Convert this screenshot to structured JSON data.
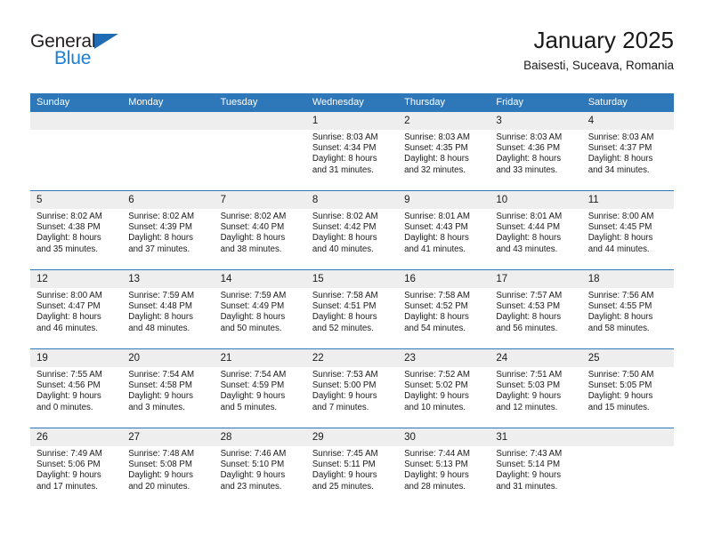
{
  "brand": {
    "name_top": "General",
    "name_bottom": "Blue",
    "accent_color": "#1b7fd4",
    "triangle_color": "#1f6cb4"
  },
  "header": {
    "title": "January 2025",
    "subtitle": "Baisesti, Suceava, Romania"
  },
  "colors": {
    "header_row": "#2e77b8",
    "daynum_band": "#eeeeee",
    "text": "#1a1a1a"
  },
  "weekday_headers": [
    "Sunday",
    "Monday",
    "Tuesday",
    "Wednesday",
    "Thursday",
    "Friday",
    "Saturday"
  ],
  "weeks": [
    [
      {
        "day": "",
        "lines": []
      },
      {
        "day": "",
        "lines": []
      },
      {
        "day": "",
        "lines": []
      },
      {
        "day": "1",
        "lines": [
          "Sunrise: 8:03 AM",
          "Sunset: 4:34 PM",
          "Daylight: 8 hours",
          "and 31 minutes."
        ]
      },
      {
        "day": "2",
        "lines": [
          "Sunrise: 8:03 AM",
          "Sunset: 4:35 PM",
          "Daylight: 8 hours",
          "and 32 minutes."
        ]
      },
      {
        "day": "3",
        "lines": [
          "Sunrise: 8:03 AM",
          "Sunset: 4:36 PM",
          "Daylight: 8 hours",
          "and 33 minutes."
        ]
      },
      {
        "day": "4",
        "lines": [
          "Sunrise: 8:03 AM",
          "Sunset: 4:37 PM",
          "Daylight: 8 hours",
          "and 34 minutes."
        ]
      }
    ],
    [
      {
        "day": "5",
        "lines": [
          "Sunrise: 8:02 AM",
          "Sunset: 4:38 PM",
          "Daylight: 8 hours",
          "and 35 minutes."
        ]
      },
      {
        "day": "6",
        "lines": [
          "Sunrise: 8:02 AM",
          "Sunset: 4:39 PM",
          "Daylight: 8 hours",
          "and 37 minutes."
        ]
      },
      {
        "day": "7",
        "lines": [
          "Sunrise: 8:02 AM",
          "Sunset: 4:40 PM",
          "Daylight: 8 hours",
          "and 38 minutes."
        ]
      },
      {
        "day": "8",
        "lines": [
          "Sunrise: 8:02 AM",
          "Sunset: 4:42 PM",
          "Daylight: 8 hours",
          "and 40 minutes."
        ]
      },
      {
        "day": "9",
        "lines": [
          "Sunrise: 8:01 AM",
          "Sunset: 4:43 PM",
          "Daylight: 8 hours",
          "and 41 minutes."
        ]
      },
      {
        "day": "10",
        "lines": [
          "Sunrise: 8:01 AM",
          "Sunset: 4:44 PM",
          "Daylight: 8 hours",
          "and 43 minutes."
        ]
      },
      {
        "day": "11",
        "lines": [
          "Sunrise: 8:00 AM",
          "Sunset: 4:45 PM",
          "Daylight: 8 hours",
          "and 44 minutes."
        ]
      }
    ],
    [
      {
        "day": "12",
        "lines": [
          "Sunrise: 8:00 AM",
          "Sunset: 4:47 PM",
          "Daylight: 8 hours",
          "and 46 minutes."
        ]
      },
      {
        "day": "13",
        "lines": [
          "Sunrise: 7:59 AM",
          "Sunset: 4:48 PM",
          "Daylight: 8 hours",
          "and 48 minutes."
        ]
      },
      {
        "day": "14",
        "lines": [
          "Sunrise: 7:59 AM",
          "Sunset: 4:49 PM",
          "Daylight: 8 hours",
          "and 50 minutes."
        ]
      },
      {
        "day": "15",
        "lines": [
          "Sunrise: 7:58 AM",
          "Sunset: 4:51 PM",
          "Daylight: 8 hours",
          "and 52 minutes."
        ]
      },
      {
        "day": "16",
        "lines": [
          "Sunrise: 7:58 AM",
          "Sunset: 4:52 PM",
          "Daylight: 8 hours",
          "and 54 minutes."
        ]
      },
      {
        "day": "17",
        "lines": [
          "Sunrise: 7:57 AM",
          "Sunset: 4:53 PM",
          "Daylight: 8 hours",
          "and 56 minutes."
        ]
      },
      {
        "day": "18",
        "lines": [
          "Sunrise: 7:56 AM",
          "Sunset: 4:55 PM",
          "Daylight: 8 hours",
          "and 58 minutes."
        ]
      }
    ],
    [
      {
        "day": "19",
        "lines": [
          "Sunrise: 7:55 AM",
          "Sunset: 4:56 PM",
          "Daylight: 9 hours",
          "and 0 minutes."
        ]
      },
      {
        "day": "20",
        "lines": [
          "Sunrise: 7:54 AM",
          "Sunset: 4:58 PM",
          "Daylight: 9 hours",
          "and 3 minutes."
        ]
      },
      {
        "day": "21",
        "lines": [
          "Sunrise: 7:54 AM",
          "Sunset: 4:59 PM",
          "Daylight: 9 hours",
          "and 5 minutes."
        ]
      },
      {
        "day": "22",
        "lines": [
          "Sunrise: 7:53 AM",
          "Sunset: 5:00 PM",
          "Daylight: 9 hours",
          "and 7 minutes."
        ]
      },
      {
        "day": "23",
        "lines": [
          "Sunrise: 7:52 AM",
          "Sunset: 5:02 PM",
          "Daylight: 9 hours",
          "and 10 minutes."
        ]
      },
      {
        "day": "24",
        "lines": [
          "Sunrise: 7:51 AM",
          "Sunset: 5:03 PM",
          "Daylight: 9 hours",
          "and 12 minutes."
        ]
      },
      {
        "day": "25",
        "lines": [
          "Sunrise: 7:50 AM",
          "Sunset: 5:05 PM",
          "Daylight: 9 hours",
          "and 15 minutes."
        ]
      }
    ],
    [
      {
        "day": "26",
        "lines": [
          "Sunrise: 7:49 AM",
          "Sunset: 5:06 PM",
          "Daylight: 9 hours",
          "and 17 minutes."
        ]
      },
      {
        "day": "27",
        "lines": [
          "Sunrise: 7:48 AM",
          "Sunset: 5:08 PM",
          "Daylight: 9 hours",
          "and 20 minutes."
        ]
      },
      {
        "day": "28",
        "lines": [
          "Sunrise: 7:46 AM",
          "Sunset: 5:10 PM",
          "Daylight: 9 hours",
          "and 23 minutes."
        ]
      },
      {
        "day": "29",
        "lines": [
          "Sunrise: 7:45 AM",
          "Sunset: 5:11 PM",
          "Daylight: 9 hours",
          "and 25 minutes."
        ]
      },
      {
        "day": "30",
        "lines": [
          "Sunrise: 7:44 AM",
          "Sunset: 5:13 PM",
          "Daylight: 9 hours",
          "and 28 minutes."
        ]
      },
      {
        "day": "31",
        "lines": [
          "Sunrise: 7:43 AM",
          "Sunset: 5:14 PM",
          "Daylight: 9 hours",
          "and 31 minutes."
        ]
      },
      {
        "day": "",
        "lines": []
      }
    ]
  ]
}
